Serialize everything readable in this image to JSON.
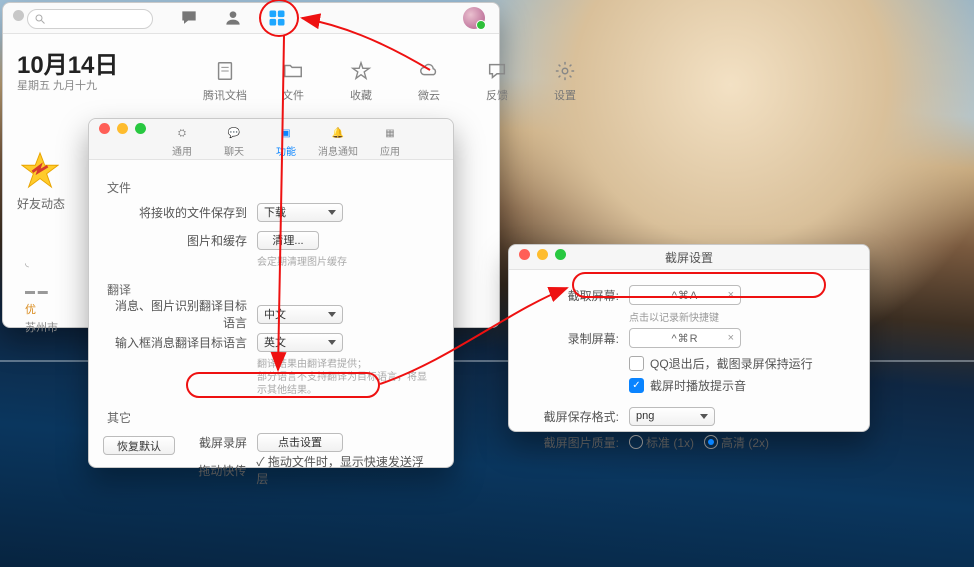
{
  "main": {
    "date_big": "10月14日",
    "date_sub": "星期五 九月十九",
    "sidebar_label": "好友动态",
    "u_label": "优",
    "city_label": "苏州市",
    "cats": [
      "腾讯文档",
      "文件",
      "收藏",
      "微云",
      "反馈",
      "设置"
    ]
  },
  "pref": {
    "tabs": [
      "通用",
      "聊天",
      "功能",
      "消息通知",
      "应用"
    ],
    "sec_file": "文件",
    "file_save_to": "将接收的文件保存到",
    "file_save_to_val": "下载",
    "pic_cache": "图片和缓存",
    "pic_cache_btn": "清理...",
    "pic_cache_hint": "会定期清理图片缓存",
    "sec_trans": "翻译",
    "trans_msg": "消息、图片识别翻译目标语言",
    "trans_msg_val": "中文",
    "trans_input": "输入框消息翻译目标语言",
    "trans_input_val": "英文",
    "trans_hint1": "翻译结果由翻译君提供；",
    "trans_hint2": "部分语言不支持翻译为目标语言，将显示其他结果。",
    "sec_other": "其它",
    "screen_label": "截屏录屏",
    "screen_btn": "点击设置",
    "drag_label": "拖动快传",
    "drag_chk": "拖动文件时，显示快速发送浮层",
    "restore": "恢复默认"
  },
  "ss": {
    "title": "截屏设置",
    "cap_label": "截取屏幕:",
    "cap_key": "^⌘A",
    "cap_hint": "点击以记录新快捷键",
    "rec_label": "录制屏幕:",
    "rec_key": "^⌘R",
    "keep_running": "QQ退出后，截图录屏保持运行",
    "play_sound": "截屏时播放提示音",
    "fmt_label": "截屏保存格式:",
    "fmt_val": "png",
    "q_label": "截屏图片质量:",
    "q_std": "标准 (1x)",
    "q_hd": "高清 (2x)"
  }
}
